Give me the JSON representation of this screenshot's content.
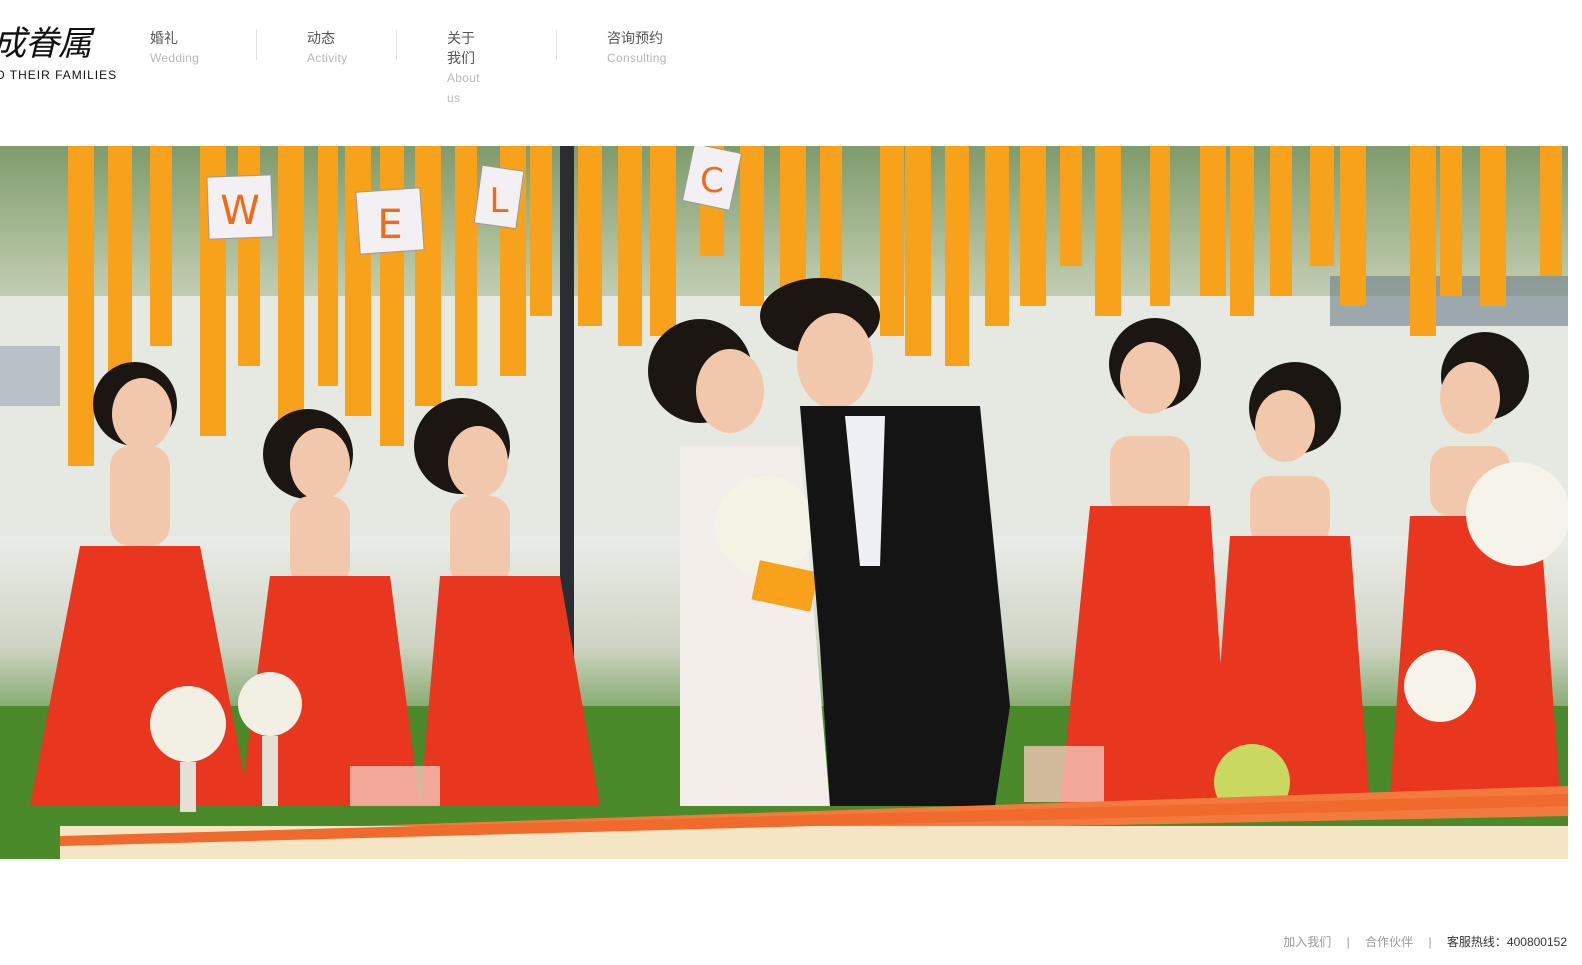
{
  "logo": {
    "mark": "成眷属",
    "tagline": "D THEIR FAMILIES"
  },
  "nav": [
    {
      "zh": "婚礼",
      "en": "Wedding"
    },
    {
      "zh": "动态",
      "en": "Activity"
    },
    {
      "zh": "关于我们",
      "en": "About us"
    },
    {
      "zh": "咨询预约",
      "en": "Consulting"
    }
  ],
  "hero": {
    "banner_letters": [
      "W",
      "E",
      "L",
      "C"
    ]
  },
  "footer": {
    "join": "加入我们",
    "partners": "合作伙伴",
    "sep": "|",
    "hotline": "客服热线：400800152"
  },
  "colors": {
    "ribbon": "#f7a21a",
    "dress": "#e8361f",
    "tablecloth": "#f27a3c",
    "suit": "#141414"
  }
}
